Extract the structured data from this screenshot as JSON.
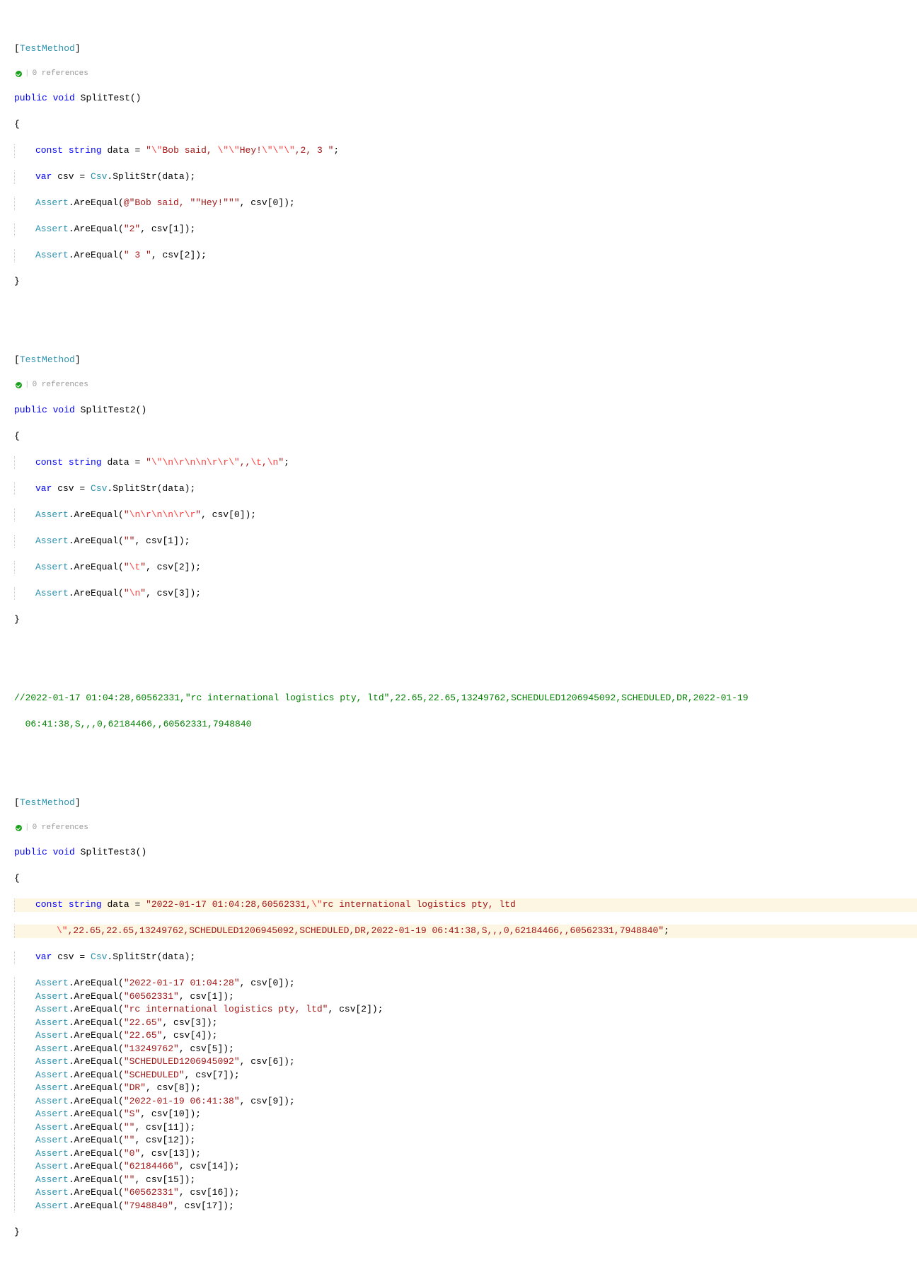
{
  "codelens": {
    "refs": "0 references"
  },
  "m1": {
    "attr": "TestMethod",
    "sig_public": "public",
    "sig_void": "void",
    "name": "SplitTest",
    "l1_const": "const",
    "l1_string": "string",
    "l1_ident": " data = ",
    "l1_q1": "\"",
    "l1_e1": "\\\"",
    "l1_s1": "Bob said, ",
    "l1_e2": "\\\"\\\"",
    "l1_s2": "Hey!",
    "l1_e3": "\\\"\\\"\\\"",
    "l1_s3": ",2, 3 ",
    "l1_q2": "\"",
    "l1_semi": ";",
    "l2_var": "var",
    "l2_rest": " csv = ",
    "l2_csv": "Csv",
    "l2_call": ".SplitStr(data);",
    "a1_cls": "Assert",
    "a1_call": ".AreEqual(",
    "a1_at": "@\"Bob said, \"\"Hey!\"\"\"",
    "a1_rest": ", csv[",
    "a1_idx": "0",
    "a1_end": "]);",
    "a2_cls": "Assert",
    "a2_call": ".AreEqual(",
    "a2_str": "\"2\"",
    "a2_rest": ", csv[",
    "a2_idx": "1",
    "a2_end": "]);",
    "a3_cls": "Assert",
    "a3_call": ".AreEqual(",
    "a3_str": "\" 3 \"",
    "a3_rest": ", csv[",
    "a3_idx": "2",
    "a3_end": "]);"
  },
  "m2": {
    "attr": "TestMethod",
    "sig_public": "public",
    "sig_void": "void",
    "name": "SplitTest2",
    "l1_const": "const",
    "l1_string": "string",
    "l1_ident": " data = ",
    "l1_q1": "\"",
    "l1_e1": "\\\"\\n\\r\\n\\n\\r\\r\\\"",
    "l1_s1": ",,",
    "l1_e2": "\\t",
    "l1_s2": ",",
    "l1_e3": "\\n",
    "l1_q2": "\"",
    "l1_semi": ";",
    "l2_var": "var",
    "l2_rest": " csv = ",
    "l2_csv": "Csv",
    "l2_call": ".SplitStr(data);",
    "a1_cls": "Assert",
    "a1_call": ".AreEqual(",
    "a1_q1": "\"",
    "a1_esc": "\\n\\r\\n\\n\\r\\r",
    "a1_q2": "\"",
    "a1_rest": ", csv[",
    "a1_idx": "0",
    "a1_end": "]);",
    "a2_cls": "Assert",
    "a2_call": ".AreEqual(",
    "a2_str": "\"\"",
    "a2_rest": ", csv[",
    "a2_idx": "1",
    "a2_end": "]);",
    "a3_cls": "Assert",
    "a3_call": ".AreEqual(",
    "a3_q1": "\"",
    "a3_esc": "\\t",
    "a3_q2": "\"",
    "a3_rest": ", csv[",
    "a3_idx": "2",
    "a3_end": "]);",
    "a4_cls": "Assert",
    "a4_call": ".AreEqual(",
    "a4_q1": "\"",
    "a4_esc": "\\n",
    "a4_q2": "\"",
    "a4_rest": ", csv[",
    "a4_idx": "3",
    "a4_end": "]);"
  },
  "comment": {
    "l1": "//2022-01-17 01:04:28,60562331,\"rc international logistics pty, ltd\",22.65,22.65,13249762,SCHEDULED1206945092,SCHEDULED,DR,2022-01-19 ",
    "l2": "  06:41:38,S,,,0,62184466,,60562331,7948840"
  },
  "m3": {
    "attr": "TestMethod",
    "sig_public": "public",
    "sig_void": "void",
    "name": "SplitTest3",
    "l1_const": "const",
    "l1_string": "string",
    "l1_ident": " data = ",
    "l1_q1": "\"",
    "l1_s1": "2022-01-17 01:04:28,60562331,",
    "l1_e1": "\\\"",
    "l1_s2": "rc international logistics pty, ltd ",
    "l1b_e1": "\\\"",
    "l1b_s1": ",22.65,22.65,13249762,SCHEDULED1206945092,SCHEDULED,DR,2022-01-19 06:41:38,S,,,0,62184466,,60562331,7948840",
    "l1b_q2": "\"",
    "l1b_semi": ";",
    "l2_var": "var",
    "l2_rest": " csv = ",
    "l2_csv": "Csv",
    "l2_call": ".SplitStr(data);",
    "asserts": [
      {
        "str": "\"2022-01-17 01:04:28\"",
        "idx": "0"
      },
      {
        "str": "\"60562331\"",
        "idx": "1"
      },
      {
        "str": "\"rc international logistics pty, ltd\"",
        "idx": "2"
      },
      {
        "str": "\"22.65\"",
        "idx": "3"
      },
      {
        "str": "\"22.65\"",
        "idx": "4"
      },
      {
        "str": "\"13249762\"",
        "idx": "5"
      },
      {
        "str": "\"SCHEDULED1206945092\"",
        "idx": "6"
      },
      {
        "str": "\"SCHEDULED\"",
        "idx": "7"
      },
      {
        "str": "\"DR\"",
        "idx": "8"
      },
      {
        "str": "\"2022-01-19 06:41:38\"",
        "idx": "9"
      },
      {
        "str": "\"S\"",
        "idx": "10"
      },
      {
        "str": "\"\"",
        "idx": "11"
      },
      {
        "str": "\"\"",
        "idx": "12"
      },
      {
        "str": "\"0\"",
        "idx": "13"
      },
      {
        "str": "\"62184466\"",
        "idx": "14"
      },
      {
        "str": "\"\"",
        "idx": "15"
      },
      {
        "str": "\"60562331\"",
        "idx": "16"
      },
      {
        "str": "\"7948840\"",
        "idx": "17"
      }
    ],
    "assert_cls": "Assert",
    "assert_call": ".AreEqual(",
    "assert_mid": ", csv[",
    "assert_end": "]);"
  }
}
